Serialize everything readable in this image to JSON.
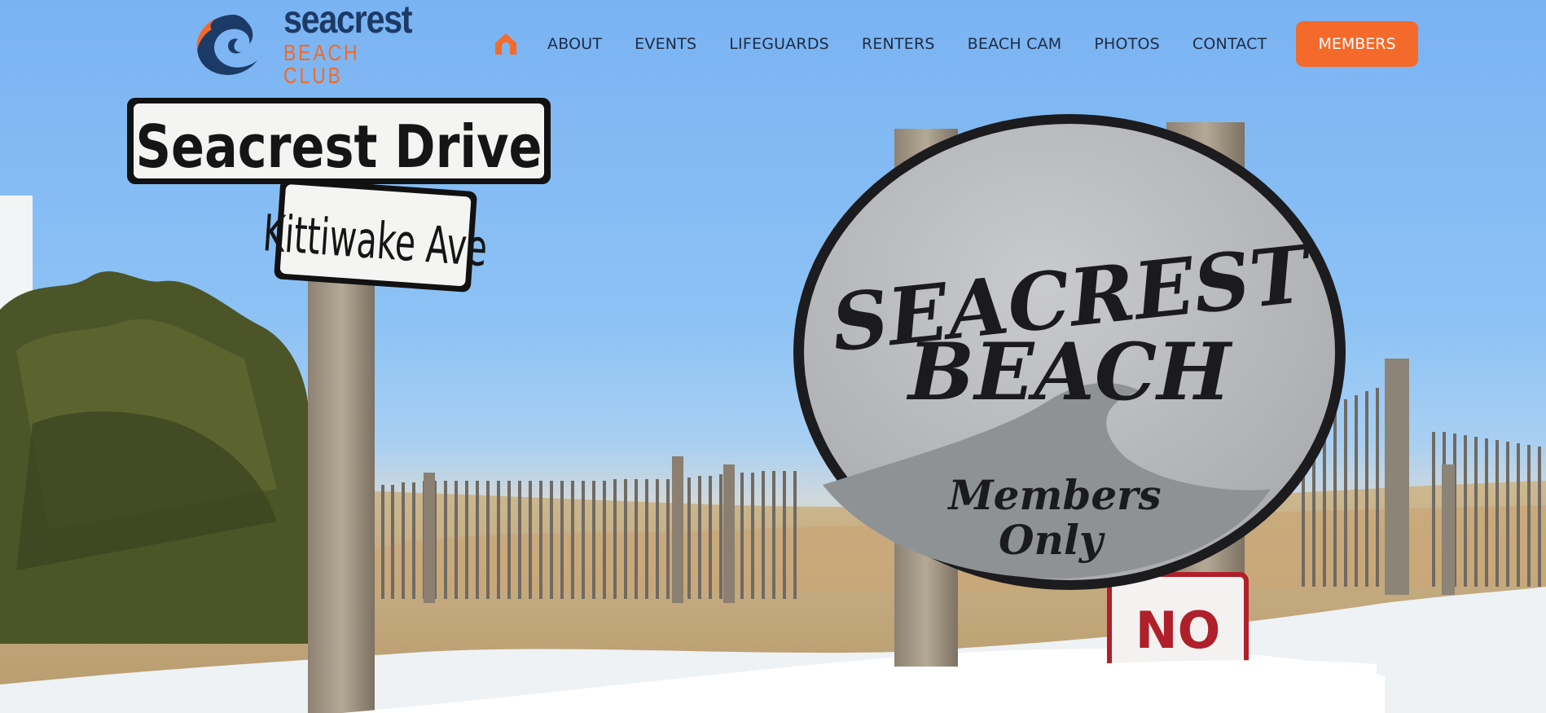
{
  "colors": {
    "accent": "#f46a2b",
    "brand_navy": "#1c3a66",
    "nav_text": "#1d2c44",
    "sky": "#86bdf3"
  },
  "logo": {
    "word": "seacrest",
    "sub": "BEACH CLUB",
    "icon": "wave-swirl-logo-icon"
  },
  "nav": {
    "home_icon": "home-icon",
    "items": [
      {
        "label": "ABOUT"
      },
      {
        "label": "EVENTS"
      },
      {
        "label": "LIFEGUARDS"
      },
      {
        "label": "RENTERS"
      },
      {
        "label": "BEACH CAM"
      },
      {
        "label": "PHOTOS"
      },
      {
        "label": "CONTACT"
      }
    ],
    "cta_label": "MEMBERS"
  },
  "hero": {
    "street_sign_top": "Seacrest Drive",
    "street_sign_bottom": "Kittiwake Ave",
    "oval_sign_line1": "SEACREST",
    "oval_sign_line2": "BEACH",
    "oval_sign_members_line1": "Members",
    "oval_sign_members_line2": "Only",
    "small_sign": "NO"
  }
}
